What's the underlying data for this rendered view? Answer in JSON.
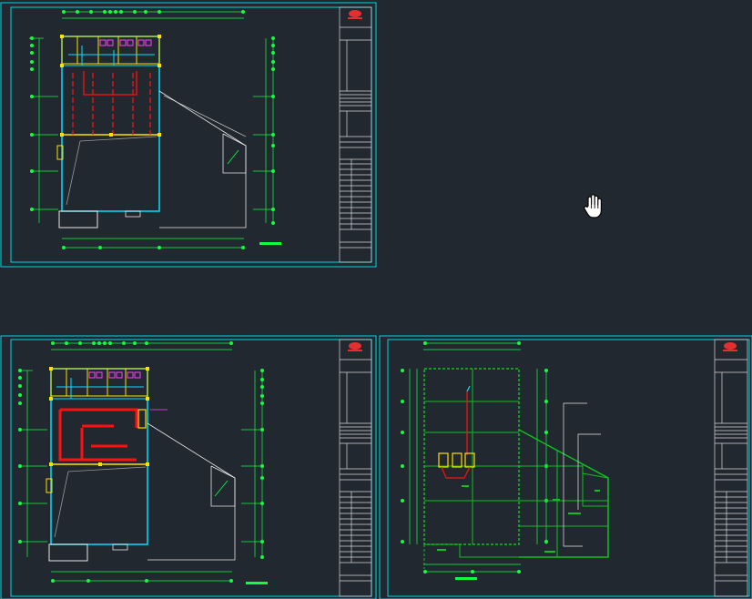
{
  "app": {
    "view": "CAD model space",
    "cursor": "pan-hand-icon"
  },
  "colors": {
    "background": "#212830",
    "sheet_border": "#00d8e0",
    "title_block": "#d9d9d9",
    "wall": "#00e0ff",
    "column": "#ffe000",
    "pipe_red": "#ff1010",
    "dim_green": "#10ff40",
    "grid_green": "#10c020",
    "magenta": "#ff40ff",
    "white_line": "#e8e8e8",
    "logo_red": "#e03030"
  },
  "sheets": [
    {
      "id": "sheet-1",
      "variant": "plan-a"
    },
    {
      "id": "sheet-2",
      "variant": "plan-b"
    },
    {
      "id": "sheet-3",
      "variant": "plan-c"
    }
  ]
}
